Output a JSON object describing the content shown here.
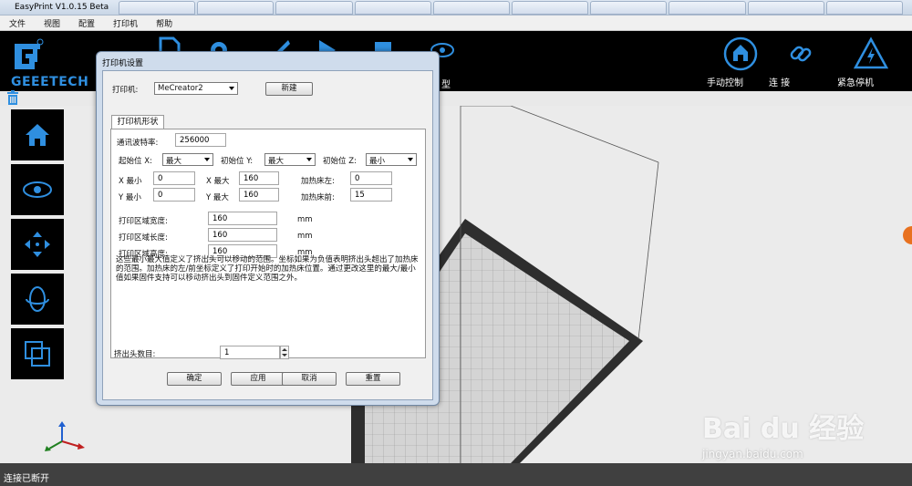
{
  "app": {
    "title": "EasyPrint   V1.0.15 Beta"
  },
  "menu": [
    "文件",
    "视图",
    "配置",
    "打印机",
    "帮助"
  ],
  "logo": {
    "text": "GEEETECH"
  },
  "toolbar": {
    "partial_label": "型",
    "manual_control": "手动控制",
    "connect": "连 接",
    "emergency_stop": "紧急停机"
  },
  "status": "连接已断开",
  "watermark": {
    "main": "Bai du 经验",
    "sub": "jingyan.baidu.com"
  },
  "dialog": {
    "title": "打印机设置",
    "printer_label": "打印机:",
    "printer_value": "MeCreator2",
    "new_button": "新建",
    "tab": "打印机形状",
    "baud_label": "通讯波特率:",
    "baud_value": "256000",
    "origin_x_label": "起始位 X:",
    "origin_x_value": "最大",
    "origin_y_label": "初始位 Y:",
    "origin_y_value": "最大",
    "origin_z_label": "初始位 Z:",
    "origin_z_value": "最小",
    "x_min_label": "X 最小",
    "x_min_value": "0",
    "x_max_label": "X 最大",
    "x_max_value": "160",
    "bed_left_label": "加热床左:",
    "bed_left_value": "0",
    "y_min_label": "Y 最小",
    "y_min_value": "0",
    "y_max_label": "Y 最大",
    "y_max_value": "160",
    "bed_front_label": "加热床前:",
    "bed_front_value": "15",
    "width_label": "打印区域宽度:",
    "width_value": "160",
    "length_label": "打印区域长度:",
    "length_value": "160",
    "height_label": "打印区域高度:",
    "height_value": "160",
    "unit": "mm",
    "description": "这些最小最大值定义了挤出头可以移动的范围。坐标如果为负值表明挤出头超出了加热床的范围。加热床的左/前坐标定义了打印开始时的加热床位置。通过更改这里的最大/最小值如果固件支持可以移动挤出头到固件定义范围之外。",
    "extruder_label": "挤出头数目:",
    "extruder_value": "1",
    "ok": "确定",
    "apply": "应用",
    "cancel": "取消",
    "reset": "重置"
  }
}
